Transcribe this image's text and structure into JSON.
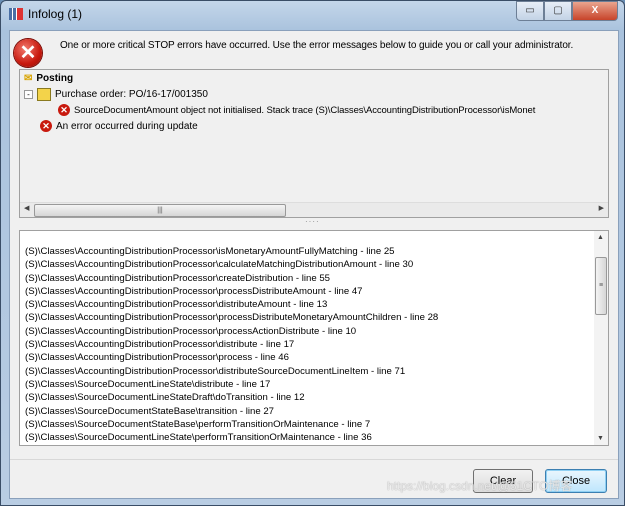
{
  "window": {
    "title": "Infolog (1)",
    "controls": {
      "minimize": "▭",
      "maximize": "▢",
      "close": "X"
    }
  },
  "header": {
    "icon": "error-stop-icon",
    "message": "One or more critical STOP errors have occurred. Use the error messages below to guide you or call your administrator."
  },
  "tree": {
    "root": "Posting",
    "purchase_order": "Purchase order: PO/16-17/001350",
    "error1": "SourceDocumentAmount object not initialised.  Stack trace  (S)\\Classes\\AccountingDistributionProcessor\\isMonet",
    "error2": "An error occurred during update"
  },
  "stack_trace": [
    "(S)\\Classes\\AccountingDistributionProcessor\\isMonetaryAmountFullyMatching - line 25",
    "(S)\\Classes\\AccountingDistributionProcessor\\calculateMatchingDistributionAmount - line 30",
    "(S)\\Classes\\AccountingDistributionProcessor\\createDistribution - line 55",
    "(S)\\Classes\\AccountingDistributionProcessor\\processDistributeAmount - line 47",
    "(S)\\Classes\\AccountingDistributionProcessor\\distributeAmount - line 13",
    "(S)\\Classes\\AccountingDistributionProcessor\\processDistributeMonetaryAmountChildren - line 28",
    "(S)\\Classes\\AccountingDistributionProcessor\\processActionDistribute - line 10",
    "(S)\\Classes\\AccountingDistributionProcessor\\distribute - line 17",
    "(S)\\Classes\\AccountingDistributionProcessor\\process - line 46",
    "(S)\\Classes\\AccountingDistributionProcessor\\distributeSourceDocumentLineItem - line 71",
    "(S)\\Classes\\SourceDocumentLineState\\distribute - line 17",
    "(S)\\Classes\\SourceDocumentLineStateDraft\\doTransition - line 12",
    "(S)\\Classes\\SourceDocumentStateBase\\transition - line 27",
    "(S)\\Classes\\SourceDocumentStateBase\\performTransitionOrMaintenance - line 7",
    "(S)\\Classes\\SourceDocumentLineState\\performTransitionOrMaintenance - line 36"
  ],
  "buttons": {
    "clear": "Clear",
    "close": "Close"
  },
  "watermark": "https://blog.csdn.net/@51CTO博客"
}
